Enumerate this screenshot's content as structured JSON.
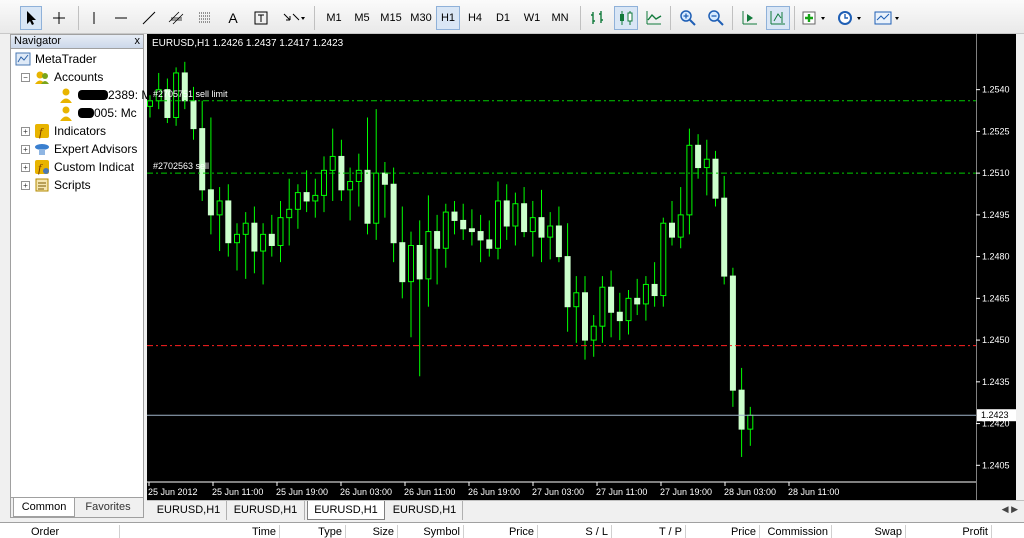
{
  "toolbar": {
    "timeframes": [
      "M1",
      "M5",
      "M15",
      "M30",
      "H1",
      "H4",
      "D1",
      "W1",
      "MN"
    ],
    "active_timeframe": "H1",
    "text_tool": "A"
  },
  "navigator": {
    "title": "Navigator",
    "close": "x",
    "items": [
      {
        "label": "MetaTrader"
      },
      {
        "label": "Accounts"
      },
      {
        "label": "2389: M"
      },
      {
        "label": "005: Mc"
      },
      {
        "label": "Indicators"
      },
      {
        "label": "Expert Advisors"
      },
      {
        "label": "Custom Indicat"
      },
      {
        "label": "Scripts"
      }
    ],
    "tabs": [
      "Common",
      "Favorites"
    ]
  },
  "chart": {
    "header": "EURUSD,H1  1.2426 1.2437 1.2417 1.2423",
    "colors": {
      "background": "#000000",
      "bull": "#00ff00",
      "bear": "#ccffcc",
      "wick": "#00ff00",
      "order_line": "#00cc00",
      "red_line": "#ff2020",
      "bid_line": "#a0b4c8",
      "axis_text": "#ffffff"
    },
    "orders": [
      {
        "label": "#2705751 sell limit",
        "price": 1.2536
      },
      {
        "label": "#2702563  sell",
        "price": 1.251
      }
    ],
    "red_line_price": 1.2448,
    "current_price": "1.2423",
    "current_price_value": 1.2423,
    "price_ticks": [
      "1.2540",
      "1.2525",
      "1.2510",
      "1.2495",
      "1.2480",
      "1.2465",
      "1.2450",
      "1.2435",
      "1.2420",
      "1.2405"
    ],
    "time_ticks": [
      "25 Jun 2012",
      "25 Jun 11:00",
      "25 Jun 19:00",
      "26 Jun 03:00",
      "26 Jun 11:00",
      "26 Jun 19:00",
      "27 Jun 03:00",
      "27 Jun 11:00",
      "27 Jun 19:00",
      "28 Jun 03:00",
      "28 Jun 11:00"
    ]
  },
  "chart_data": {
    "type": "candlestick",
    "symbol": "EURUSD,H1",
    "ylim": [
      1.2399,
      1.256
    ],
    "candles": [
      [
        1.2534,
        1.2538,
        1.253,
        1.2536
      ],
      [
        1.2536,
        1.2546,
        1.2533,
        1.254
      ],
      [
        1.254,
        1.2544,
        1.2528,
        1.253
      ],
      [
        1.253,
        1.2548,
        1.2527,
        1.2546
      ],
      [
        1.2546,
        1.255,
        1.2533,
        1.2536
      ],
      [
        1.2536,
        1.2541,
        1.2522,
        1.2526
      ],
      [
        1.2526,
        1.2536,
        1.25,
        1.2504
      ],
      [
        1.2504,
        1.253,
        1.2488,
        1.2495
      ],
      [
        1.2495,
        1.2505,
        1.2482,
        1.25
      ],
      [
        1.25,
        1.2506,
        1.248,
        1.2485
      ],
      [
        1.2485,
        1.2492,
        1.2475,
        1.2488
      ],
      [
        1.2488,
        1.2496,
        1.2472,
        1.2492
      ],
      [
        1.2492,
        1.2498,
        1.2474,
        1.2482
      ],
      [
        1.2482,
        1.2492,
        1.247,
        1.2488
      ],
      [
        1.2488,
        1.2495,
        1.248,
        1.2484
      ],
      [
        1.2484,
        1.25,
        1.2478,
        1.2494
      ],
      [
        1.2494,
        1.2508,
        1.2484,
        1.2497
      ],
      [
        1.2497,
        1.2506,
        1.249,
        1.2503
      ],
      [
        1.2503,
        1.2511,
        1.2496,
        1.25
      ],
      [
        1.25,
        1.2508,
        1.2494,
        1.2502
      ],
      [
        1.2502,
        1.2516,
        1.2496,
        1.2511
      ],
      [
        1.2511,
        1.2526,
        1.25,
        1.2516
      ],
      [
        1.2516,
        1.2522,
        1.25,
        1.2504
      ],
      [
        1.2504,
        1.2512,
        1.2493,
        1.2507
      ],
      [
        1.2507,
        1.2517,
        1.2498,
        1.2511
      ],
      [
        1.2511,
        1.253,
        1.2488,
        1.2492
      ],
      [
        1.2492,
        1.2533,
        1.2486,
        1.251
      ],
      [
        1.251,
        1.2514,
        1.2494,
        1.2506
      ],
      [
        1.2506,
        1.2512,
        1.2478,
        1.2485
      ],
      [
        1.2485,
        1.2498,
        1.2465,
        1.2471
      ],
      [
        1.2471,
        1.2489,
        1.2451,
        1.2484
      ],
      [
        1.2484,
        1.2493,
        1.2437,
        1.2472
      ],
      [
        1.2472,
        1.2502,
        1.2462,
        1.2489
      ],
      [
        1.2489,
        1.2495,
        1.247,
        1.2483
      ],
      [
        1.2483,
        1.2499,
        1.2476,
        1.2496
      ],
      [
        1.2496,
        1.25,
        1.2488,
        1.2493
      ],
      [
        1.2493,
        1.2499,
        1.2486,
        1.249
      ],
      [
        1.249,
        1.2497,
        1.2484,
        1.2489
      ],
      [
        1.2489,
        1.2495,
        1.2478,
        1.2486
      ],
      [
        1.2486,
        1.2493,
        1.248,
        1.2483
      ],
      [
        1.2483,
        1.2507,
        1.2479,
        1.25
      ],
      [
        1.25,
        1.2506,
        1.2486,
        1.2491
      ],
      [
        1.2491,
        1.2503,
        1.2484,
        1.2499
      ],
      [
        1.2499,
        1.2505,
        1.2487,
        1.2489
      ],
      [
        1.2489,
        1.25,
        1.248,
        1.2494
      ],
      [
        1.2494,
        1.2504,
        1.2478,
        1.2487
      ],
      [
        1.2487,
        1.2496,
        1.2479,
        1.2491
      ],
      [
        1.2491,
        1.2498,
        1.2478,
        1.248
      ],
      [
        1.248,
        1.2492,
        1.2453,
        1.2462
      ],
      [
        1.2462,
        1.2473,
        1.2449,
        1.2467
      ],
      [
        1.2467,
        1.2473,
        1.2443,
        1.245
      ],
      [
        1.245,
        1.2459,
        1.2444,
        1.2455
      ],
      [
        1.2455,
        1.2473,
        1.2449,
        1.2469
      ],
      [
        1.2469,
        1.2475,
        1.2451,
        1.246
      ],
      [
        1.246,
        1.2467,
        1.245,
        1.2457
      ],
      [
        1.2457,
        1.2468,
        1.2452,
        1.2465
      ],
      [
        1.2465,
        1.2472,
        1.2459,
        1.2463
      ],
      [
        1.2463,
        1.2473,
        1.2457,
        1.247
      ],
      [
        1.247,
        1.2478,
        1.2462,
        1.2466
      ],
      [
        1.2466,
        1.2494,
        1.2462,
        1.2492
      ],
      [
        1.2492,
        1.25,
        1.2484,
        1.2487
      ],
      [
        1.2487,
        1.2505,
        1.2483,
        1.2495
      ],
      [
        1.2495,
        1.2526,
        1.2488,
        1.252
      ],
      [
        1.252,
        1.2524,
        1.2508,
        1.2512
      ],
      [
        1.2512,
        1.2522,
        1.2502,
        1.2515
      ],
      [
        1.2515,
        1.2518,
        1.2498,
        1.2501
      ],
      [
        1.2501,
        1.2509,
        1.247,
        1.2473
      ],
      [
        1.2473,
        1.2476,
        1.2426,
        1.2432
      ],
      [
        1.2432,
        1.244,
        1.2408,
        1.2418
      ],
      [
        1.2418,
        1.2426,
        1.2412,
        1.2423
      ]
    ]
  },
  "chart_tabs": [
    "EURUSD,H1",
    "EURUSD,H1",
    "EURUSD,H1",
    "EURUSD,H1"
  ],
  "active_chart_tab": 2,
  "terminal": {
    "columns": [
      "Order",
      "Time",
      "Type",
      "Size",
      "Symbol",
      "Price",
      "S / L",
      "T / P",
      "Price",
      "Commission",
      "Swap",
      "Profit"
    ]
  }
}
